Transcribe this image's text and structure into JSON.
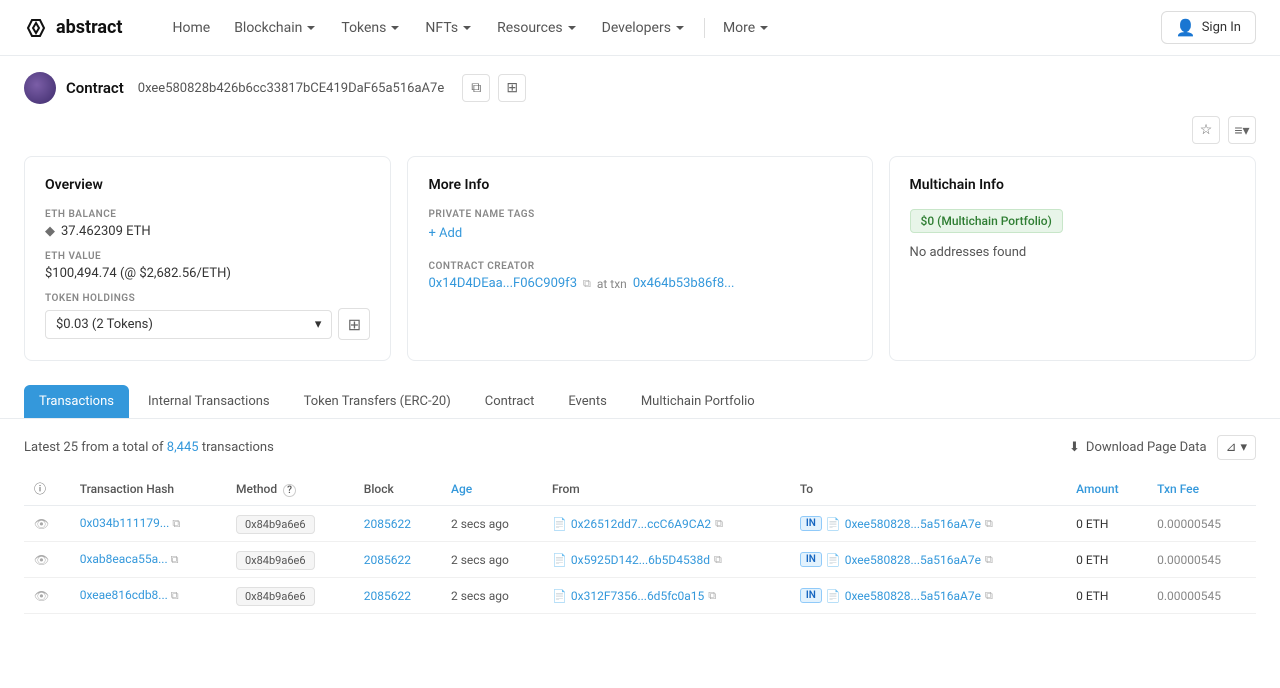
{
  "navbar": {
    "logo": "abstract",
    "nav_items": [
      {
        "label": "Home",
        "has_dropdown": false
      },
      {
        "label": "Blockchain",
        "has_dropdown": true
      },
      {
        "label": "Tokens",
        "has_dropdown": true
      },
      {
        "label": "NFTs",
        "has_dropdown": true
      },
      {
        "label": "Resources",
        "has_dropdown": true
      },
      {
        "label": "Developers",
        "has_dropdown": true
      },
      {
        "label": "More",
        "has_dropdown": true
      }
    ],
    "sign_in": "Sign In"
  },
  "page": {
    "badge": "Contract",
    "address": "0xee580828b426b6cc33817bCE419DaF65a516aA7e"
  },
  "overview": {
    "title": "Overview",
    "eth_balance_label": "ETH BALANCE",
    "eth_balance": "37.462309 ETH",
    "eth_value_label": "ETH VALUE",
    "eth_value": "$100,494.74 (@ $2,682.56/ETH)",
    "token_holdings_label": "TOKEN HOLDINGS",
    "token_holdings": "$0.03 (2 Tokens)"
  },
  "more_info": {
    "title": "More Info",
    "private_name_tags_label": "PRIVATE NAME TAGS",
    "add_label": "+ Add",
    "contract_creator_label": "CONTRACT CREATOR",
    "creator_addr": "0x14D4DEaa...F06C909f3",
    "at_txn_label": "at txn",
    "creator_txn": "0x464b53b86f8..."
  },
  "multichain": {
    "title": "Multichain Info",
    "badge": "$0 (Multichain Portfolio)",
    "no_addresses": "No addresses found"
  },
  "tabs": [
    {
      "label": "Transactions",
      "active": true
    },
    {
      "label": "Internal Transactions",
      "active": false
    },
    {
      "label": "Token Transfers (ERC-20)",
      "active": false
    },
    {
      "label": "Contract",
      "active": false
    },
    {
      "label": "Events",
      "active": false
    },
    {
      "label": "Multichain Portfolio",
      "active": false
    }
  ],
  "transactions": {
    "summary_prefix": "Latest 25 from a total of",
    "total_count": "8,445",
    "summary_suffix": "transactions",
    "download_label": "Download Page Data",
    "columns": {
      "info": "",
      "hash": "Transaction Hash",
      "method": "Method",
      "method_info": "?",
      "block": "Block",
      "age": "Age",
      "from": "From",
      "to": "To",
      "amount": "Amount",
      "txn_fee": "Txn Fee"
    },
    "rows": [
      {
        "hash": "0x034b111179...",
        "method": "0x84b9a6e6",
        "block": "2085622",
        "age": "2 secs ago",
        "from": "0x26512dd7...ccC6A9CA2",
        "direction": "IN",
        "to": "0xee580828...5a516aA7e",
        "amount": "0 ETH",
        "txn_fee": "0.00000545"
      },
      {
        "hash": "0xab8eaca55a...",
        "method": "0x84b9a6e6",
        "block": "2085622",
        "age": "2 secs ago",
        "from": "0x5925D142...6b5D4538d",
        "direction": "IN",
        "to": "0xee580828...5a516aA7e",
        "amount": "0 ETH",
        "txn_fee": "0.00000545"
      },
      {
        "hash": "0xeae816cdb8...",
        "method": "0x84b9a6e6",
        "block": "2085622",
        "age": "2 secs ago",
        "from": "0x312F7356...6d5fc0a15",
        "direction": "IN",
        "to": "0xee580828...5a516aA7e",
        "amount": "0 ETH",
        "txn_fee": "0.00000545"
      }
    ]
  }
}
